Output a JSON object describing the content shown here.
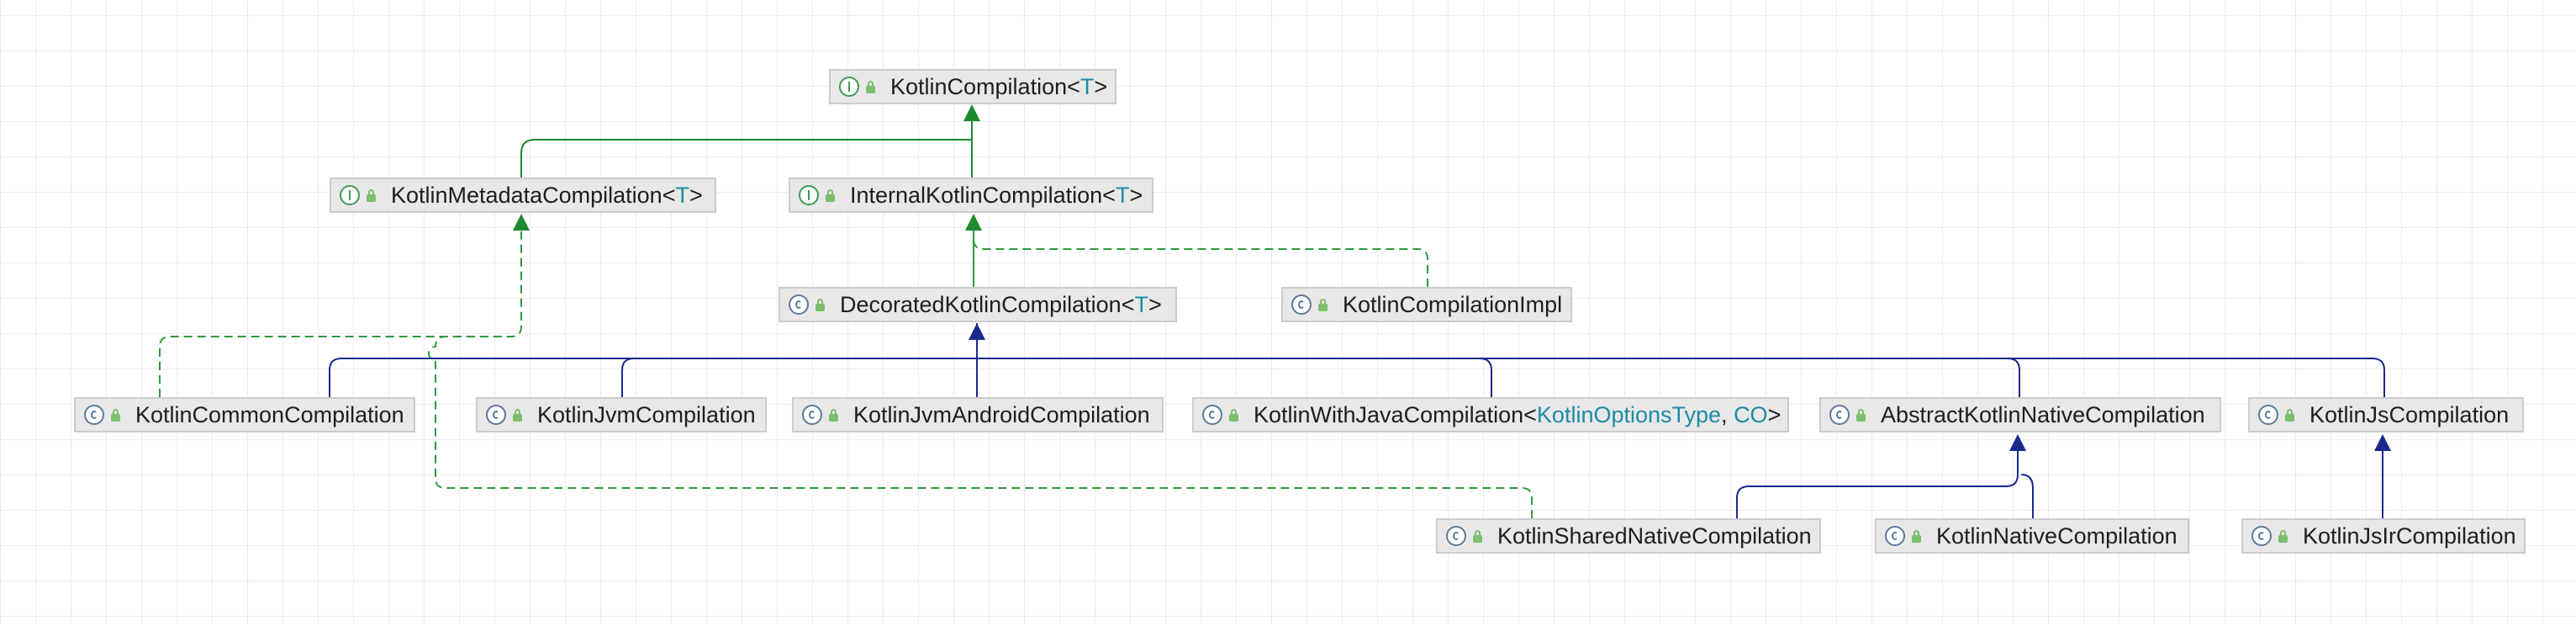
{
  "diagram": {
    "nodes": [
      {
        "id": "kotlin-compilation",
        "name": "KotlinCompilation",
        "type_params": [
          "T"
        ],
        "kind": "interface"
      },
      {
        "id": "kotlin-metadata-compilation",
        "name": "KotlinMetadataCompilation",
        "type_params": [
          "T"
        ],
        "kind": "interface"
      },
      {
        "id": "internal-kotlin-compilation",
        "name": "InternalKotlinCompilation",
        "type_params": [
          "T"
        ],
        "kind": "interface"
      },
      {
        "id": "decorated-kotlin-compilation",
        "name": "DecoratedKotlinCompilation",
        "type_params": [
          "T"
        ],
        "kind": "abstract-class"
      },
      {
        "id": "kotlin-compilation-impl",
        "name": "KotlinCompilationImpl",
        "type_params": [],
        "kind": "class"
      },
      {
        "id": "kotlin-common-compilation",
        "name": "KotlinCommonCompilation",
        "type_params": [],
        "kind": "class"
      },
      {
        "id": "kotlin-jvm-compilation",
        "name": "KotlinJvmCompilation",
        "type_params": [],
        "kind": "class"
      },
      {
        "id": "kotlin-jvm-android-compilation",
        "name": "KotlinJvmAndroidCompilation",
        "type_params": [],
        "kind": "class"
      },
      {
        "id": "kotlin-with-java-compilation",
        "name": "KotlinWithJavaCompilation",
        "type_params": [
          "KotlinOptionsType",
          "CO"
        ],
        "kind": "class"
      },
      {
        "id": "abstract-kotlin-native-compilation",
        "name": "AbstractKotlinNativeCompilation",
        "type_params": [],
        "kind": "abstract-class"
      },
      {
        "id": "kotlin-js-compilation",
        "name": "KotlinJsCompilation",
        "type_params": [],
        "kind": "class"
      },
      {
        "id": "kotlin-shared-native-compilation",
        "name": "KotlinSharedNativeCompilation",
        "type_params": [],
        "kind": "class"
      },
      {
        "id": "kotlin-native-compilation",
        "name": "KotlinNativeCompilation",
        "type_params": [],
        "kind": "class"
      },
      {
        "id": "kotlin-js-ir-compilation",
        "name": "KotlinJsIrCompilation",
        "type_params": [],
        "kind": "class"
      }
    ],
    "edges": [
      {
        "from": "kotlin-metadata-compilation",
        "to": "kotlin-compilation",
        "relation": "extends-interface"
      },
      {
        "from": "internal-kotlin-compilation",
        "to": "kotlin-compilation",
        "relation": "extends-interface"
      },
      {
        "from": "decorated-kotlin-compilation",
        "to": "internal-kotlin-compilation",
        "relation": "implements"
      },
      {
        "from": "kotlin-compilation-impl",
        "to": "internal-kotlin-compilation",
        "relation": "implements"
      },
      {
        "from": "kotlin-common-compilation",
        "to": "kotlin-metadata-compilation",
        "relation": "implements"
      },
      {
        "from": "kotlin-shared-native-compilation",
        "to": "kotlin-metadata-compilation",
        "relation": "implements"
      },
      {
        "from": "kotlin-common-compilation",
        "to": "decorated-kotlin-compilation",
        "relation": "extends"
      },
      {
        "from": "kotlin-jvm-compilation",
        "to": "decorated-kotlin-compilation",
        "relation": "extends"
      },
      {
        "from": "kotlin-jvm-android-compilation",
        "to": "decorated-kotlin-compilation",
        "relation": "extends"
      },
      {
        "from": "kotlin-with-java-compilation",
        "to": "decorated-kotlin-compilation",
        "relation": "extends"
      },
      {
        "from": "abstract-kotlin-native-compilation",
        "to": "decorated-kotlin-compilation",
        "relation": "extends"
      },
      {
        "from": "kotlin-js-compilation",
        "to": "decorated-kotlin-compilation",
        "relation": "extends"
      },
      {
        "from": "kotlin-shared-native-compilation",
        "to": "abstract-kotlin-native-compilation",
        "relation": "extends"
      },
      {
        "from": "kotlin-native-compilation",
        "to": "abstract-kotlin-native-compilation",
        "relation": "extends"
      },
      {
        "from": "kotlin-js-ir-compilation",
        "to": "kotlin-js-compilation",
        "relation": "extends"
      }
    ]
  },
  "colors": {
    "background": "#ffffff",
    "grid": "#ececec",
    "node_fill": "#e8e8e8",
    "node_border": "#cbcbcb",
    "type_param": "#1c8ca3",
    "interface_edge": "#1e8a2e",
    "class_edge": "#1a2a8c"
  }
}
